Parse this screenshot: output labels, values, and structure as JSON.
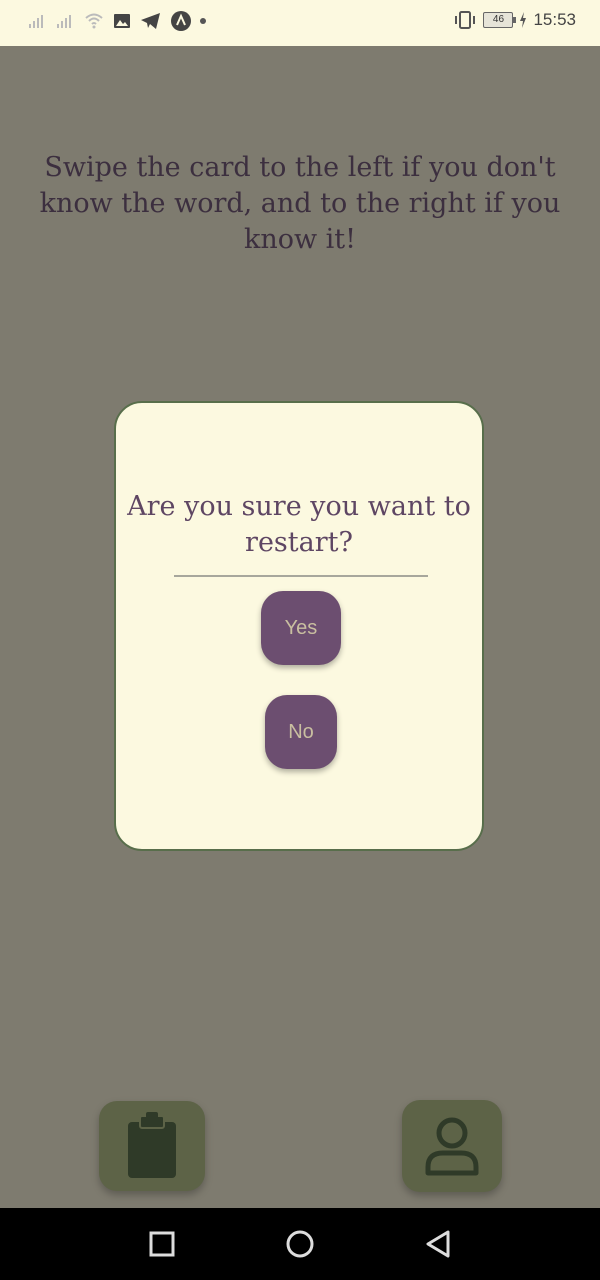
{
  "status_bar": {
    "time": "15:53",
    "battery_level": "46",
    "icons": [
      "signal-icon",
      "signal-icon",
      "wifi-icon",
      "gallery-icon",
      "telegram-icon",
      "app-icon",
      "dot-icon",
      "vibrate-icon",
      "battery-icon",
      "charging-icon"
    ]
  },
  "main": {
    "instruction": "Swipe the card to the left if you don't know the word, and to the right if you know it!"
  },
  "dialog": {
    "title": "Are you sure you want to restart?",
    "yes_label": "Yes",
    "no_label": "No"
  },
  "bottom_actions": {
    "left_icon": "clipboard-icon",
    "right_icon": "profile-icon"
  },
  "nav_bar": {
    "icons": [
      "recents-icon",
      "home-icon",
      "back-icon"
    ]
  },
  "colors": {
    "background": "#7e7b6f",
    "card": "#fcf9e0",
    "card_border": "#586e4b",
    "button": "#6c4e70",
    "button_text": "#c9bfa0",
    "fab": "#5d6347",
    "fab_icon": "#2f3a28",
    "title_text": "#5e4663",
    "instruction_text": "#3c2f3f"
  }
}
